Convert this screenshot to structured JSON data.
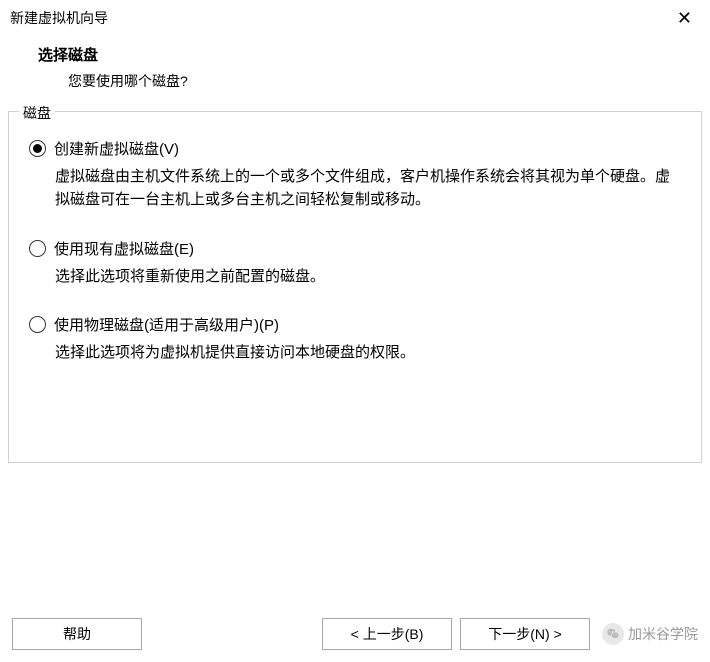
{
  "window": {
    "title": "新建虚拟机向导"
  },
  "header": {
    "title": "选择磁盘",
    "subtitle": "您要使用哪个磁盘?"
  },
  "fieldset": {
    "label": "磁盘"
  },
  "options": [
    {
      "label": "创建新虚拟磁盘(V)",
      "description": "虚拟磁盘由主机文件系统上的一个或多个文件组成，客户机操作系统会将其视为单个硬盘。虚拟磁盘可在一台主机上或多台主机之间轻松复制或移动。",
      "selected": true
    },
    {
      "label": "使用现有虚拟磁盘(E)",
      "description": "选择此选项将重新使用之前配置的磁盘。",
      "selected": false
    },
    {
      "label": "使用物理磁盘(适用于高级用户)(P)",
      "description": "选择此选项将为虚拟机提供直接访问本地硬盘的权限。",
      "selected": false
    }
  ],
  "buttons": {
    "help": "帮助",
    "back": "< 上一步(B)",
    "next": "下一步(N) >"
  },
  "watermark": {
    "text": "加米谷学院"
  }
}
